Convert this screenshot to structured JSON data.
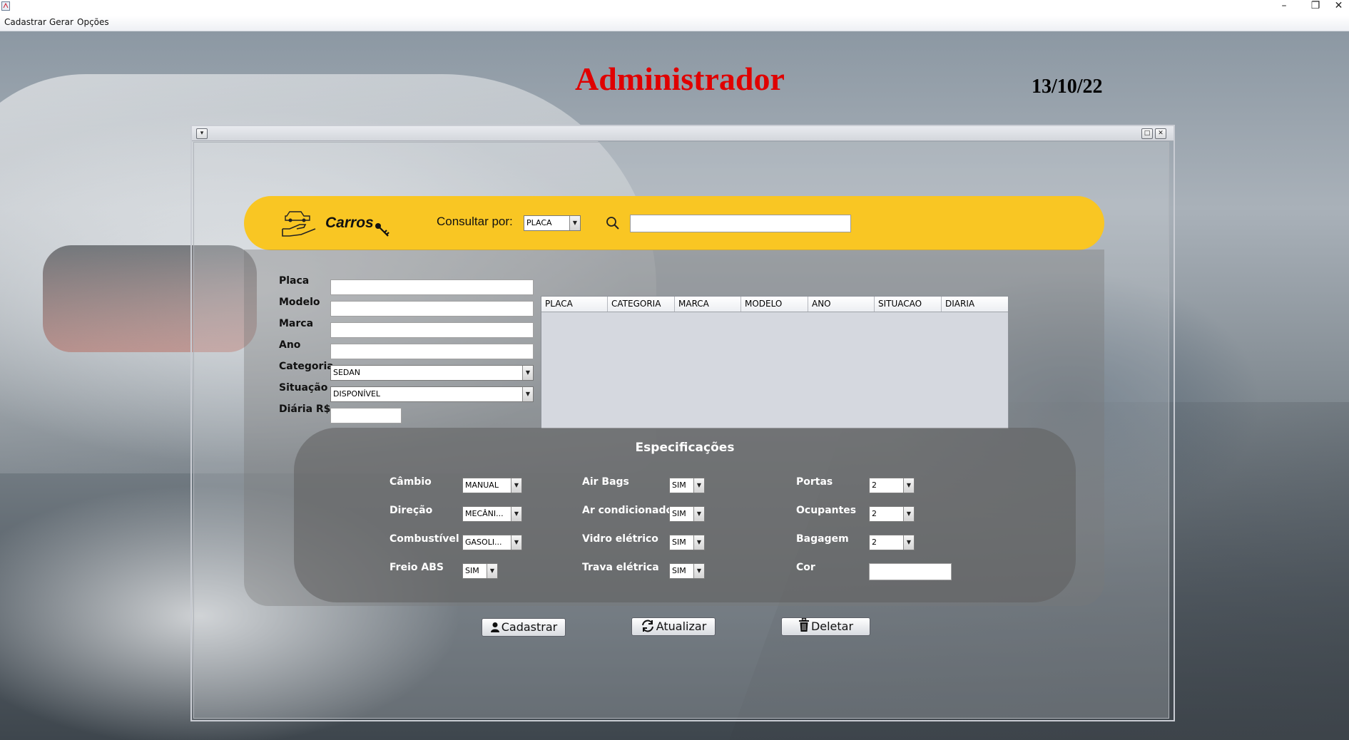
{
  "window": {
    "min_glyph": "–",
    "restore_glyph": "❐",
    "close_glyph": "✕"
  },
  "menu": [
    "Cadastrar",
    "Gerar",
    "Opções"
  ],
  "header": {
    "role_title": "Administrador",
    "date": "13/10/22",
    "title_color": "#e00000"
  },
  "internal_frame": {
    "menu_glyph": "▾",
    "maximize_glyph": "□",
    "close_glyph": "✕"
  },
  "search_bar": {
    "title": "Carros",
    "consult_label": "Consultar por:",
    "consult_value": "PLACA",
    "search_value": "",
    "accent": "#f9c623"
  },
  "form": {
    "placa_label": "Placa",
    "modelo_label": "Modelo",
    "marca_label": "Marca",
    "ano_label": "Ano",
    "categoria_label": "Categoria",
    "categoria_value": "SEDAN",
    "situacao_label": "Situação",
    "situacao_value": "DISPONÍVEL",
    "diaria_label": "Diária R$"
  },
  "table": {
    "columns": [
      "PLACA",
      "CATEGORIA",
      "MARCA",
      "MODELO",
      "ANO",
      "SITUACAO",
      "DIARIA"
    ],
    "rows": []
  },
  "specs": {
    "title": "Especificações",
    "cambio_label": "Câmbio",
    "cambio_value": "MANUAL",
    "direcao_label": "Direção",
    "direcao_value": "MECÂNI...",
    "combustivel_label": "Combustível",
    "combustivel_value": "GASOLI...",
    "freio_label": "Freio ABS",
    "freio_value": "SIM",
    "airbags_label": "Air Bags",
    "airbags_value": "SIM",
    "ar_label": "Ar condicionado",
    "ar_value": "SIM",
    "vidro_label": "Vidro elétrico",
    "vidro_value": "SIM",
    "trava_label": "Trava elétrica",
    "trava_value": "SIM",
    "portas_label": "Portas",
    "portas_value": "2",
    "ocupantes_label": "Ocupantes",
    "ocupantes_value": "2",
    "bagagem_label": "Bagagem",
    "bagagem_value": "2",
    "cor_label": "Cor"
  },
  "actions": {
    "cadastrar": "Cadastrar",
    "atualizar": "Atualizar",
    "deletar": "Deletar"
  },
  "icons": [
    "app-icon",
    "car-hand-key-icon",
    "search-icon",
    "user-icon",
    "refresh-icon",
    "trash-icon"
  ]
}
